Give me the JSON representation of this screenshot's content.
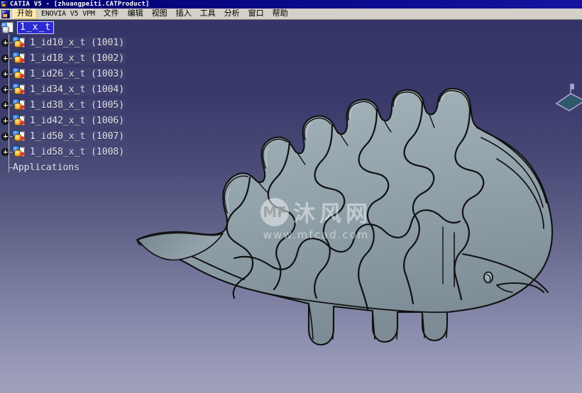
{
  "window": {
    "title": "CATIA V5 - [zhuangpeiti.CATProduct]",
    "icon": "catia-app-icon"
  },
  "menubar": {
    "app_icon": "catia-app-icon",
    "items": [
      {
        "label": "开始",
        "name": "menu-start",
        "selected": true,
        "mono": false
      },
      {
        "label": "ENOVIA V5 VPM",
        "name": "menu-enovia-v5-vpm",
        "selected": false,
        "mono": true
      },
      {
        "label": "文件",
        "name": "menu-file",
        "selected": false,
        "mono": false
      },
      {
        "label": "编辑",
        "name": "menu-edit",
        "selected": false,
        "mono": false
      },
      {
        "label": "视图",
        "name": "menu-view",
        "selected": false,
        "mono": false
      },
      {
        "label": "插入",
        "name": "menu-insert",
        "selected": false,
        "mono": false
      },
      {
        "label": "工具",
        "name": "menu-tools",
        "selected": false,
        "mono": false
      },
      {
        "label": "分析",
        "name": "menu-analyze",
        "selected": false,
        "mono": false
      },
      {
        "label": "窗口",
        "name": "menu-window",
        "selected": false,
        "mono": false
      },
      {
        "label": "帮助",
        "name": "menu-help",
        "selected": false,
        "mono": false
      }
    ]
  },
  "spec_tree": {
    "root": {
      "label": "1_x_t",
      "selected": true,
      "icon": "product-icon"
    },
    "nodes": [
      {
        "label": "1_id10_x_t  (1001)",
        "icon": "part-icon",
        "expander": "plus"
      },
      {
        "label": "1_id18_x_t  (1002)",
        "icon": "part-icon",
        "expander": "plus"
      },
      {
        "label": "1_id26_x_t  (1003)",
        "icon": "part-icon",
        "expander": "plus"
      },
      {
        "label": "1_id34_x_t  (1004)",
        "icon": "part-icon",
        "expander": "plus"
      },
      {
        "label": "1_id38_x_t  (1005)",
        "icon": "part-icon",
        "expander": "plus"
      },
      {
        "label": "1_id42_x_t  (1006)",
        "icon": "part-icon",
        "expander": "plus"
      },
      {
        "label": "1_id50_x_t  (1007)",
        "icon": "part-icon",
        "expander": "plus"
      },
      {
        "label": "1_id58_x_t  (1008)",
        "icon": "part-icon",
        "expander": "plus"
      }
    ],
    "applications_label": "Applications"
  },
  "viewport": {
    "model_description": "3D shaded stegosaurus dinosaur 3D-puzzle assembly",
    "background_top_color": "#343566",
    "background_bottom_color": "#a0a2bd",
    "model_fill_color": "#93a3ac",
    "model_edge_color": "#111111",
    "compass_name": "navigation-compass"
  },
  "watermark": {
    "logo_text": "MF",
    "brand_cn": "沐风网",
    "url": "www.mfcad.com"
  }
}
